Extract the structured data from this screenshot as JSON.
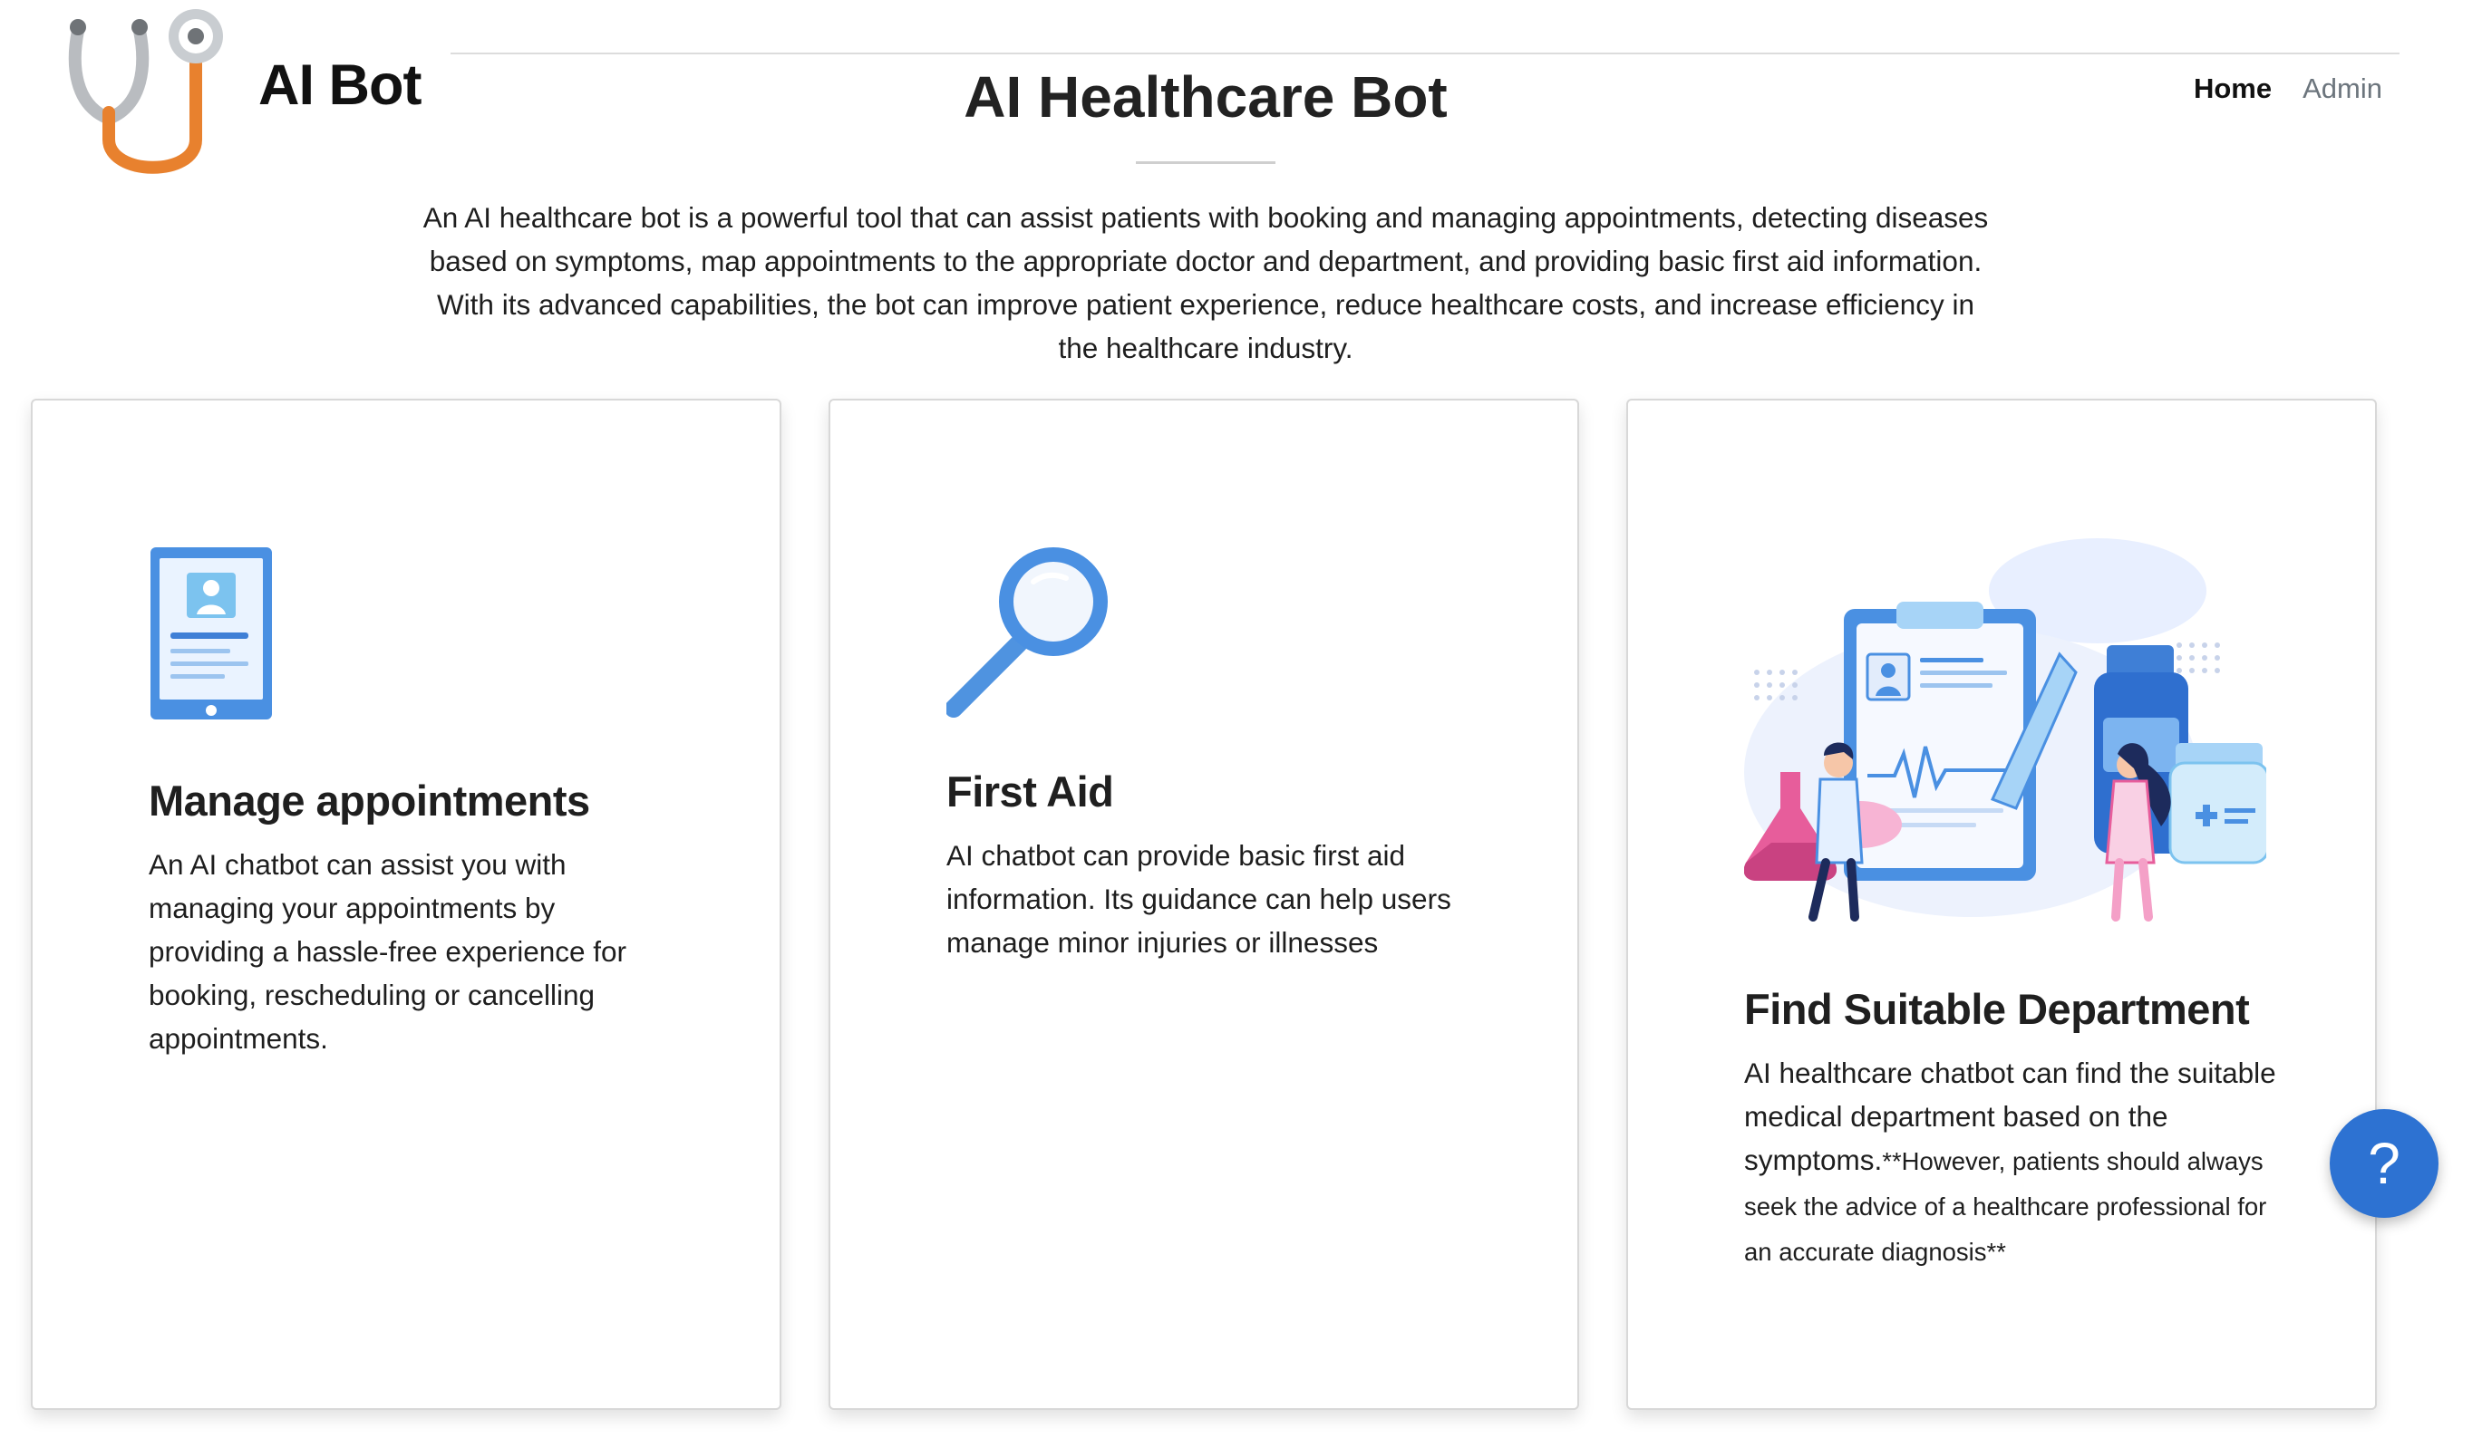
{
  "brand": {
    "name": "AI Bot",
    "logo_icon": "stethoscope-icon"
  },
  "nav": {
    "home": "Home",
    "admin": "Admin"
  },
  "hero": {
    "title": "AI Healthcare Bot",
    "description": "An AI healthcare bot is a powerful tool that can assist patients with booking and managing appointments, detecting diseases based on symptoms, map appointments to the appropriate doctor and department, and providing basic first aid information. With its advanced capabilities, the bot can improve patient experience, reduce healthcare costs, and increase efficiency in the healthcare industry."
  },
  "cards": [
    {
      "icon": "tablet-profile-icon",
      "title": "Manage appointments",
      "text": "An AI chatbot can assist you with managing your appointments by providing a hassle-free experience for booking, rescheduling or cancelling appointments."
    },
    {
      "icon": "magnifying-glass-icon",
      "title": "First Aid",
      "text": "AI chatbot can provide basic first aid information. Its guidance can help users manage minor injuries or illnesses"
    },
    {
      "icon": "medical-team-illustration",
      "title": "Find Suitable Department",
      "text": "AI healthcare chatbot can find the suitable medical department based on the symptoms.",
      "note": "**However, patients should always seek the advice of a healthcare professional for an accurate diagnosis**"
    }
  ],
  "help_button": {
    "label": "?",
    "icon": "help-icon"
  },
  "colors": {
    "accent": "#2d72d2",
    "logo_orange": "#e8812e",
    "logo_gray": "#b9bcc0"
  }
}
